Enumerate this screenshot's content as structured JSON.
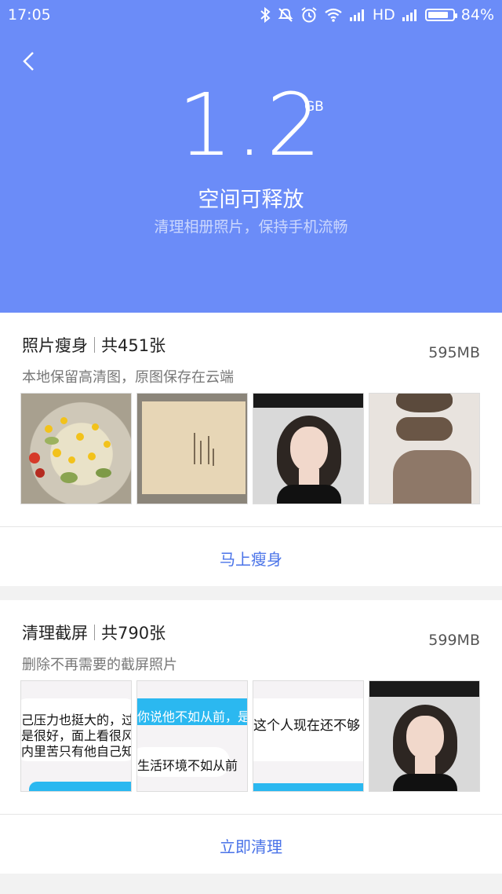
{
  "status_bar": {
    "time": "17:05",
    "network": "HD",
    "battery": "84%",
    "battery_level": 0.84
  },
  "header": {
    "amount": "1.2",
    "unit": "GB",
    "title": "空间可释放",
    "subtitle": "清理相册照片，保持手机流畅"
  },
  "photo_slim": {
    "name": "照片瘦身",
    "count": "共451张",
    "description": "本地保留高清图，原图保存在云端",
    "size": "595MB",
    "thumbnails": [
      "salad",
      "paper",
      "portrait",
      "hair-collage"
    ],
    "action": "马上瘦身"
  },
  "screenshots": {
    "name": "清理截屏",
    "count": "共790张",
    "description": "删除不再需要的截屏照片",
    "size": "599MB",
    "thumbnails": [
      {
        "lines": [
          "己压力也挺大的，过",
          "是很好，面上看很风",
          "内里苦只有他自己知"
        ]
      },
      {
        "lines": [
          "你说他不如从前，是人",
          "生活环境不如从前"
        ]
      },
      {
        "lines": [
          "这个人现在还不够"
        ]
      },
      {
        "type": "portrait"
      }
    ],
    "action": "立即清理"
  },
  "icons": [
    "bluetooth-icon",
    "mute-icon",
    "alarm-icon",
    "wifi-icon",
    "signal-icon",
    "battery-icon",
    "back-icon"
  ],
  "colors": {
    "header_bg": "#6b8cf8",
    "accent": "#4a73e8",
    "chat_blue": "#2bb8f0"
  }
}
